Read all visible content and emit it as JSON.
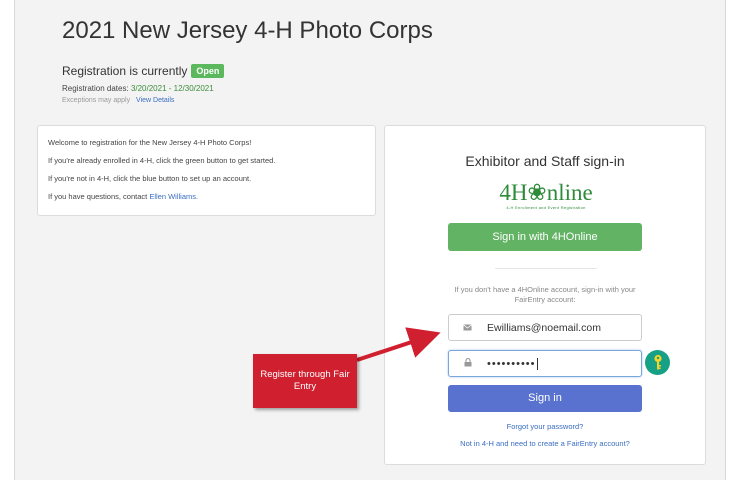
{
  "page": {
    "title": "2021 New Jersey 4-H Photo Corps",
    "registration_label": "Registration is currently",
    "status_badge": "Open",
    "dates_label": "Registration dates:",
    "dates_value": "3/20/2021 - 12/30/2021",
    "exceptions_text": "Exceptions may apply",
    "view_details": "View Details"
  },
  "welcome": {
    "line1": "Welcome to registration for the New Jersey 4-H Photo Corps!",
    "line2": "If you're already enrolled in 4-H, click the green button to get started.",
    "line3": "If you're not in 4-H, click the blue button to set up an account.",
    "line4_prefix": "If you have questions, contact",
    "contact_link": "Ellen Williams."
  },
  "signin": {
    "title": "Exhibitor and Staff sign-in",
    "logo_text": "4H❀nline",
    "logo_subtext": "4-H Enrollment and Event Registration",
    "btn_4honline": "Sign in with 4HOnline",
    "helper_text": "If you don't have a 4HOnline account, sign-in with your FairEntry account:",
    "email_value": "Ewilliams@noemail.com",
    "password_value": "••••••••••",
    "btn_signin": "Sign in",
    "forgot_link": "Forgot your password?",
    "create_link": "Not in 4-H and need to create a FairEntry account?"
  },
  "annotation": {
    "callout_text": "Register through Fair Entry"
  },
  "icons": {
    "email": "envelope-icon",
    "password": "lock-icon",
    "key": "key-icon"
  },
  "colors": {
    "open_badge": "#5cb85c",
    "btn_green": "#63b365",
    "btn_blue": "#5a72cf",
    "link": "#3a6ec2",
    "callout": "#d0202f",
    "key_badge": "#16a085"
  }
}
